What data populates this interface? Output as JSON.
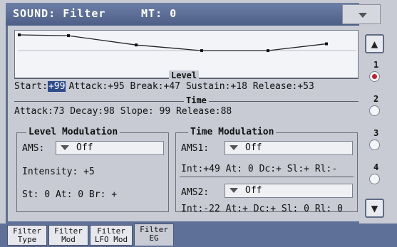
{
  "header": {
    "title": "SOUND: Filter",
    "mt": "MT: 0"
  },
  "graph": {
    "envelope_levels": [
      99,
      95,
      47,
      18,
      18,
      53
    ]
  },
  "level_section": {
    "label": "Level",
    "start_label": "Start:",
    "start_value": "+99",
    "rest": "Attack:+95 Break:+47 Sustain:+18 Release:+53"
  },
  "time_section": {
    "label": "Time",
    "line": "Attack:73 Decay:98  Slope: 99  Release:88"
  },
  "level_mod": {
    "title": "Level Modulation",
    "ams_label": "AMS:",
    "ams_value": "Off",
    "intensity": "Intensity: +5",
    "params": "St: 0   At: 0   Br: +"
  },
  "time_mod": {
    "title": "Time Modulation",
    "ams1_label": "AMS1:",
    "ams1_value": "Off",
    "ams1_params": "Int:+49  At: 0  Dc:+  Sl:+  Rl:-",
    "ams2_label": "AMS2:",
    "ams2_value": "Off",
    "ams2_params": "Int:-22  At:+  Dc:+  Sl: 0  Rl: 0"
  },
  "sidebar": {
    "pages": [
      "1",
      "2",
      "3",
      "4"
    ],
    "active_page": "1",
    "up_icon": "arrow-up-icon",
    "down_icon": "arrow-down-icon"
  },
  "tabs": [
    {
      "line1": "Filter",
      "line2": "Type"
    },
    {
      "line1": "Filter",
      "line2": "Mod"
    },
    {
      "line1": "Filter",
      "line2": "LFO Mod"
    },
    {
      "line1": "Filter",
      "line2": "EG"
    }
  ],
  "colors": {
    "header": "#5b6d95",
    "highlight": "#2e4a8a",
    "active_dot": "#c22030"
  }
}
